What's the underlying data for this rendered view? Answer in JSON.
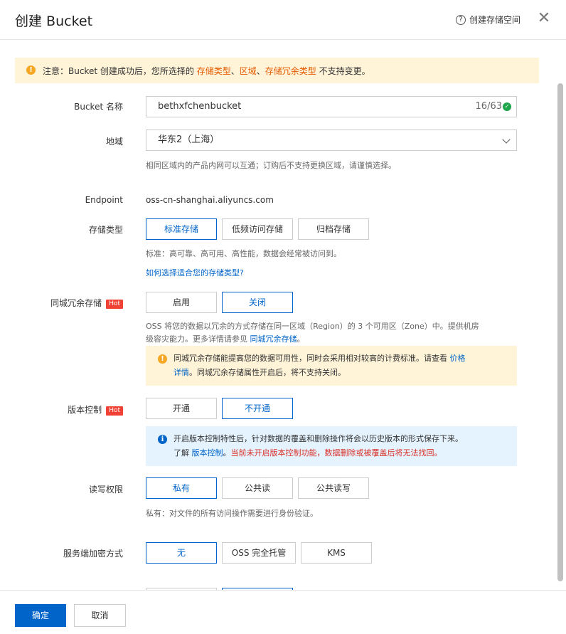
{
  "header": {
    "title": "创建 Bucket",
    "help_icon": "question-circle-icon",
    "help_label": "创建存储空间",
    "close_icon": "close-icon"
  },
  "notice": {
    "icon": "warning-icon",
    "prefix": "注意：Bucket 创建成功后，您所选择的 ",
    "hl1": "存储类型",
    "sep1": "、",
    "hl2": "区域",
    "sep2": "、",
    "hl3": "存储冗余类型",
    "suffix": " 不支持变更。"
  },
  "name": {
    "label": "Bucket 名称",
    "value": "bethxfchenbucket",
    "count": "16/63",
    "valid_icon": "check-circle-icon"
  },
  "region": {
    "label": "地域",
    "value": "华东2（上海）",
    "arrow_icon": "chevron-down-icon",
    "hint": "相同区域内的产品内网可以互通；订购后不支持更换区域，请谨慎选择。"
  },
  "endpoint": {
    "label": "Endpoint",
    "value": "oss-cn-shanghai.aliyuncs.com"
  },
  "storage": {
    "label": "存储类型",
    "options": [
      "标准存储",
      "低频访问存储",
      "归档存储"
    ],
    "hint": "标准：高可靠、高可用、高性能，数据会经常被访问到。",
    "link": "如何选择适合您的存储类型?"
  },
  "zrs": {
    "label": "同城冗余存储",
    "badge": "Hot",
    "options": [
      "启用",
      "关闭"
    ],
    "desc1": "OSS 将您的数据以冗余的方式存储在同一区域（Region）的 3 个可用区（Zone）中。提供机房",
    "desc2": "级容灾能力。更多详情请参见 ",
    "desc_link": "同城冗余存储",
    "desc_end": "。",
    "tip_icon": "warning-icon",
    "tip1": "同城冗余存储能提高您的数据可用性，同时会采用相对较高的计费标准。请查看 ",
    "tip_link": "价格",
    "tip_link2": "详情",
    "tip2": "。同城冗余存储属性开启后，将不支持关闭。"
  },
  "versioning": {
    "label": "版本控制",
    "badge": "Hot",
    "options": [
      "开通",
      "不开通"
    ],
    "tip_icon": "info-icon",
    "tip1": "开启版本控制特性后，针对数据的覆盖和删除操作将会以历史版本的形式保存下来。",
    "tip2_prefix": "了解 ",
    "tip2_link": "版本控制",
    "tip2_sep": "。",
    "tip2_red": "当前未开启版本控制功能，数据删除或被覆盖后将无法找回。"
  },
  "acl": {
    "label": "读写权限",
    "options": [
      "私有",
      "公共读",
      "公共读写"
    ],
    "hint": "私有：对文件的所有访问操作需要进行身份验证。"
  },
  "encryption": {
    "label": "服务端加密方式",
    "options": [
      "无",
      "OSS 完全托管",
      "KMS"
    ]
  },
  "footer": {
    "ok": "确定",
    "cancel": "取消"
  },
  "colors": {
    "primary": "#0064c8",
    "orange": "#e55c00",
    "red": "#d93026",
    "notice_bg": "#fff3d8",
    "info_bg": "#e5f3ff",
    "hot": "#f04134"
  }
}
